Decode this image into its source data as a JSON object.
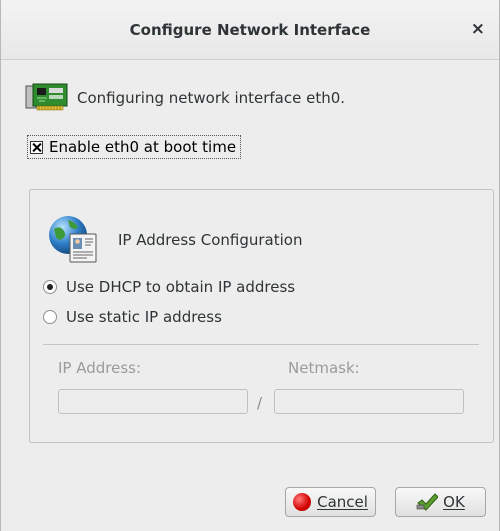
{
  "window": {
    "title": "Configure Network Interface",
    "close_glyph": "×"
  },
  "header": {
    "text": "Configuring network interface eth0.",
    "icon": "network-card-icon"
  },
  "boot": {
    "label": "Enable eth0 at boot time",
    "checked": true
  },
  "ip_config": {
    "title": "IP Address Configuration",
    "icon": "network-globe-icon",
    "options": [
      {
        "label": "Use DHCP to obtain IP address",
        "selected": true
      },
      {
        "label": "Use static IP address",
        "selected": false
      }
    ],
    "ip_label": "IP Address:",
    "netmask_label": "Netmask:",
    "ip_value": "",
    "netmask_value": "",
    "separator": "/"
  },
  "buttons": {
    "cancel": "Cancel",
    "ok": "OK"
  },
  "colors": {
    "dialog_bg": "#ededed",
    "text": "#2e3436",
    "disabled_text": "#9b9b9b",
    "cancel_red": "#d40000",
    "ok_green": "#4e9a06"
  }
}
